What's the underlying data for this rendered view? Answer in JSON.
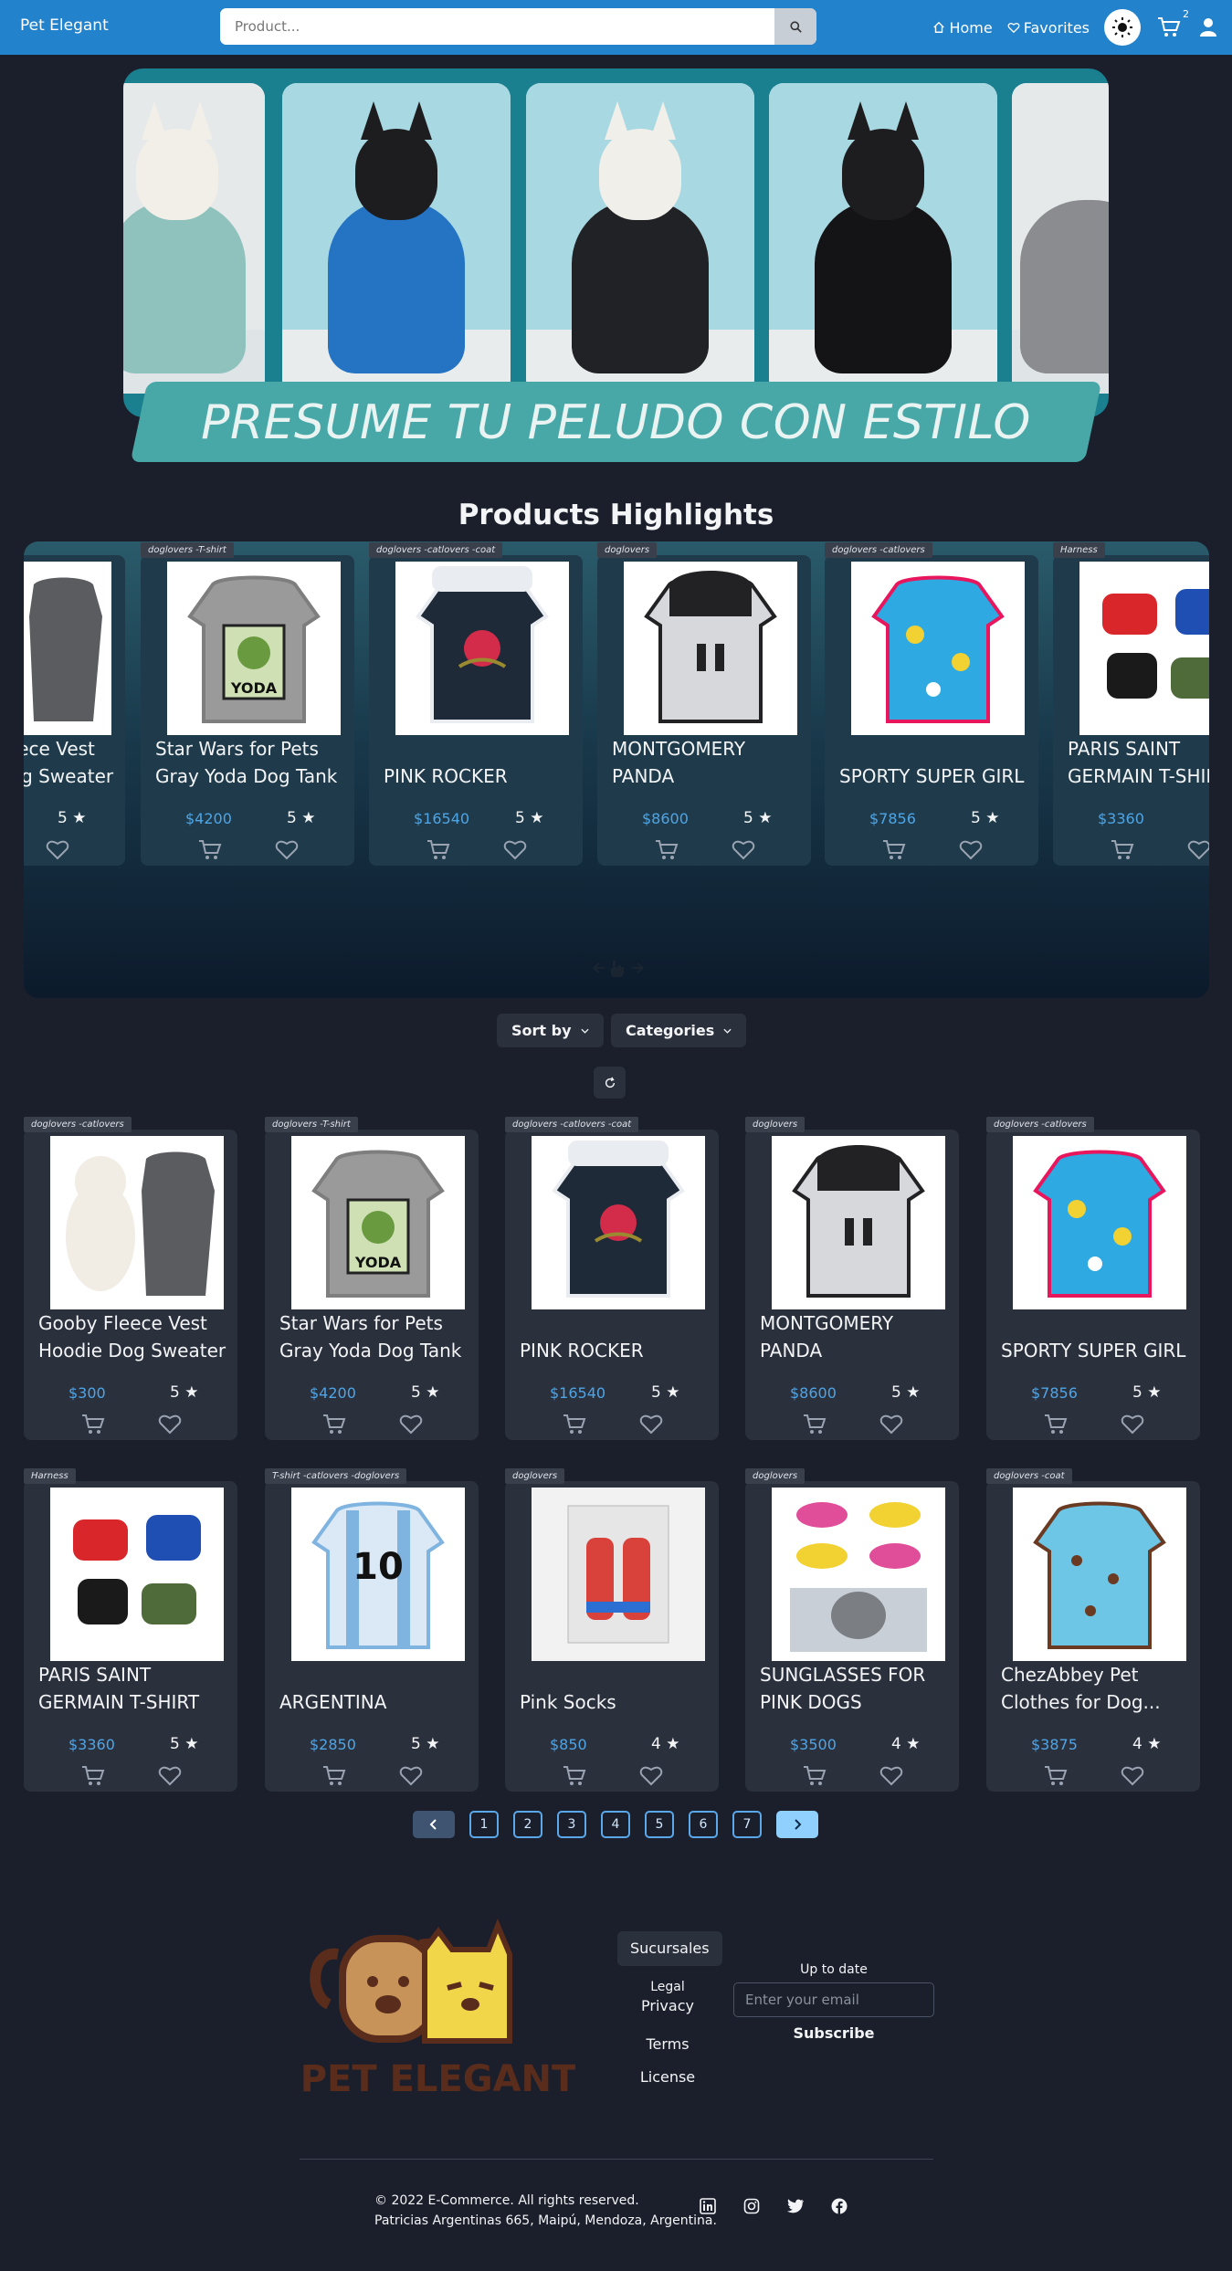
{
  "navbar": {
    "brand": "Pet Elegant",
    "search_placeholder": "Product...",
    "home_label": "Home",
    "favorites_label": "Favorites",
    "cart_count": "2"
  },
  "hero": {
    "slogan": "PRESUME TU PELUDO CON ESTILO"
  },
  "highlights": {
    "title": "Products Highlights",
    "cards": [
      {
        "tag": "",
        "name": "Gooby Fleece Vest Hoodie Dog Sweater",
        "price": "",
        "rating": "5 ★"
      },
      {
        "tag": "doglovers -T-shirt",
        "name": "Star Wars for Pets Gray Yoda Dog Tank",
        "price": "$4200",
        "rating": "5 ★"
      },
      {
        "tag": "doglovers -catlovers -coat",
        "name": "PINK ROCKER",
        "price": "$16540",
        "rating": "5 ★"
      },
      {
        "tag": "doglovers",
        "name": "MONTGOMERY PANDA",
        "price": "$8600",
        "rating": "5 ★"
      },
      {
        "tag": "doglovers -catlovers",
        "name": "SPORTY SUPER GIRL",
        "price": "$7856",
        "rating": "5 ★"
      },
      {
        "tag": "Harness",
        "name": "PARIS SAINT GERMAIN T-SHIRT",
        "price": "$3360",
        "rating": ""
      }
    ]
  },
  "controls": {
    "sort_label": "Sort by",
    "categories_label": "Categories"
  },
  "products": [
    {
      "tag": "doglovers -catlovers",
      "name": "Gooby Fleece Vest Hoodie Dog Sweater",
      "price": "$300",
      "rating": "5 ★"
    },
    {
      "tag": "doglovers -T-shirt",
      "name": "Star Wars for Pets Gray Yoda Dog Tank",
      "price": "$4200",
      "rating": "5 ★"
    },
    {
      "tag": "doglovers -catlovers -coat",
      "name": "PINK ROCKER",
      "price": "$16540",
      "rating": "5 ★"
    },
    {
      "tag": "doglovers",
      "name": "MONTGOMERY PANDA",
      "price": "$8600",
      "rating": "5 ★"
    },
    {
      "tag": "doglovers -catlovers",
      "name": "SPORTY SUPER GIRL",
      "price": "$7856",
      "rating": "5 ★"
    },
    {
      "tag": "Harness",
      "name": "PARIS SAINT GERMAIN T-SHIRT",
      "price": "$3360",
      "rating": "5 ★"
    },
    {
      "tag": "T-shirt -catlovers -doglovers",
      "name": "ARGENTINA",
      "price": "$2850",
      "rating": "5 ★"
    },
    {
      "tag": "doglovers",
      "name": "Pink Socks",
      "price": "$850",
      "rating": "4 ★"
    },
    {
      "tag": "doglovers",
      "name": "SUNGLASSES FOR PINK DOGS",
      "price": "$3500",
      "rating": "4 ★"
    },
    {
      "tag": "doglovers -coat",
      "name": "ChezAbbey Pet Clothes for Dog...",
      "price": "$3875",
      "rating": "4 ★"
    }
  ],
  "pagination": {
    "pages": [
      "1",
      "2",
      "3",
      "4",
      "5",
      "6",
      "7"
    ]
  },
  "footer": {
    "logo_text": "PET ELEGANT",
    "sucursales_label": "Sucursales",
    "legal_title": "Legal",
    "legal_links": [
      "Privacy",
      "Terms",
      "License"
    ],
    "newsletter_title": "Up to date",
    "email_placeholder": "Enter your email",
    "subscribe_label": "Subscribe",
    "copyright": "© 2022 E-Commerce. All rights reserved.",
    "address": "Patricias Argentinas 665, Maipú, Mendoza, Argentina."
  },
  "colors": {
    "navbar": "#2282cb",
    "background": "#1b1f2b",
    "card": "#2b303d",
    "price": "#4ea5e6",
    "hero": "#1a7f8e"
  },
  "icons": [
    "search-icon",
    "home-icon",
    "heart-icon",
    "sun-icon",
    "cart-icon",
    "user-icon",
    "chevron-down-icon",
    "refresh-icon",
    "chevron-left-icon",
    "chevron-right-icon",
    "swipe-hand-icon",
    "linkedin-icon",
    "instagram-icon",
    "twitter-icon",
    "facebook-icon"
  ]
}
